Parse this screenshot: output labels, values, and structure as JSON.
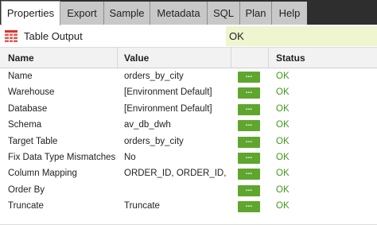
{
  "tabs": [
    {
      "label": "Properties",
      "active": true
    },
    {
      "label": "Export",
      "active": false
    },
    {
      "label": "Sample",
      "active": false
    },
    {
      "label": "Metadata",
      "active": false
    },
    {
      "label": "SQL",
      "active": false
    },
    {
      "label": "Plan",
      "active": false
    },
    {
      "label": "Help",
      "active": false
    }
  ],
  "component": {
    "title": "Table Output",
    "status": "OK",
    "icon": "table-output-icon"
  },
  "columns": {
    "name": "Name",
    "value": "Value",
    "status": "Status"
  },
  "button_label": "...",
  "properties": [
    {
      "name": "Name",
      "value": "orders_by_city",
      "status": "OK"
    },
    {
      "name": "Warehouse",
      "value": "[Environment Default]",
      "status": "OK"
    },
    {
      "name": "Database",
      "value": "[Environment Default]",
      "status": "OK"
    },
    {
      "name": "Schema",
      "value": "av_db_dwh",
      "status": "OK"
    },
    {
      "name": "Target Table",
      "value": "orders_by_city",
      "status": "OK"
    },
    {
      "name": "Fix Data Type Mismatches",
      "value": "No",
      "status": "OK"
    },
    {
      "name": "Column Mapping",
      "value": "ORDER_ID, ORDER_ID, O...",
      "status": "OK"
    },
    {
      "name": "Order By",
      "value": "",
      "status": "OK"
    },
    {
      "name": "Truncate",
      "value": "Truncate",
      "status": "OK"
    }
  ],
  "colors": {
    "ok_green": "#3e9a1a",
    "button_green": "#5fa62e",
    "status_bg": "#eef5cf",
    "tabbar_bg": "#2e2e2e"
  }
}
